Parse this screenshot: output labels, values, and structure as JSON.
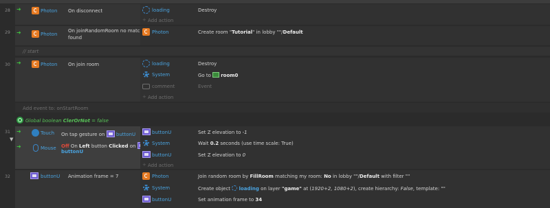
{
  "events": [
    {
      "number": "28",
      "conditions": [
        {
          "icon": "photon-icon",
          "object": "Photon",
          "text": "On disconnect"
        }
      ],
      "actions": [
        {
          "icon": "loading-icon",
          "object": "loading",
          "text": "Destroy"
        }
      ],
      "add_action": "Add action"
    },
    {
      "number": "29",
      "conditions": [
        {
          "icon": "photon-icon",
          "object": "Photon",
          "text_line1": "On joinRandomRoom no match",
          "text_line2": "found"
        }
      ],
      "actions": [
        {
          "icon": "photon-icon",
          "object": "Photon",
          "text_pre": "Create room \"",
          "text_bold1": "Tutorial",
          "text_mid": "\" in lobby \"\"/",
          "text_bold2": "Default"
        }
      ],
      "add_action": ""
    },
    {
      "number": "30",
      "comment": "// start",
      "conditions": [
        {
          "icon": "photon-icon",
          "object": "Photon",
          "text": "On join room"
        }
      ],
      "actions": [
        {
          "icon": "loading-icon",
          "object": "loading",
          "text": "Destroy"
        },
        {
          "icon": "system-icon",
          "object": "System",
          "text_pre": "Go to ",
          "text_bold": "room0"
        },
        {
          "icon": "comment-icon",
          "object": "comment",
          "text": "Event"
        }
      ],
      "add_action": "Add action"
    },
    {
      "add_event": "Add event to: onStartRoom"
    },
    {
      "global_var_prefix": "Global boolean",
      "global_var_name": "ClerOrNot",
      "global_var_value": "= false"
    },
    {
      "number": "31",
      "conditions": [
        {
          "icon": "touch-icon",
          "object": "Touch",
          "text_pre": "On tap gesture on",
          "target": "buttonU"
        },
        {
          "icon": "mouse-icon",
          "object": "Mouse",
          "not": "Off",
          "text_pre": "On",
          "bold1": "Left",
          "text_mid": "button",
          "bold2": "Clicked",
          "text_post": "on",
          "target": "buttonU"
        }
      ],
      "actions": [
        {
          "icon": "button-icon",
          "object": "buttonU",
          "text_pre": "Set Z elevation to ",
          "text_italic": "-1"
        },
        {
          "icon": "system-icon",
          "object": "System",
          "text_pre": "Wait ",
          "text_bold": "0.2",
          "text_post": " seconds (use time scale: True)"
        },
        {
          "icon": "button-icon",
          "object": "buttonU",
          "text_pre": "Set Z elevation to ",
          "text_italic": "0"
        }
      ],
      "add_action": "Add action"
    },
    {
      "number": "32",
      "conditions": [
        {
          "icon": "button-icon",
          "object": "buttonU",
          "text": "Animation frame = 7"
        }
      ],
      "actions": [
        {
          "icon": "photon-icon",
          "object": "Photon",
          "text_pre": "Join random room by ",
          "b1": "FillRoom",
          "t2": " matching my room: ",
          "b2": "No",
          "t3": " in lobby \"\"/",
          "b3": "Default",
          "t4": " with filter \"\""
        },
        {
          "icon": "system-icon",
          "object": "System",
          "text_pre": "Create object ",
          "target": "loading",
          "t2": " on layer ",
          "b2": "\"game\"",
          "t3": " at (",
          "i3": "1920+2, 1080+2",
          "t4": "), create hierarchy: ",
          "i4": "False",
          "t5": ", template: \"\""
        },
        {
          "icon": "button-icon",
          "object": "buttonU",
          "text_pre": "Set animation frame to ",
          "text_bold": "34"
        }
      ]
    }
  ]
}
